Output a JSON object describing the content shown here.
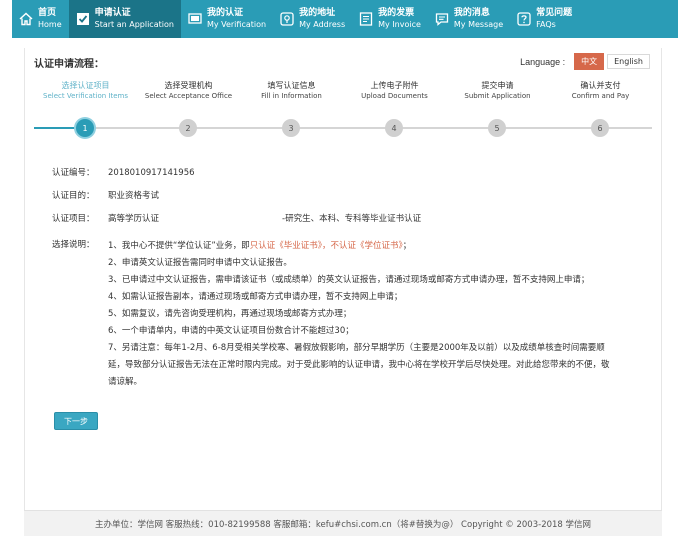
{
  "nav": [
    {
      "zh": "首页",
      "en": "Home",
      "icon": "home-icon"
    },
    {
      "zh": "申请认证",
      "en": "Start an Application",
      "icon": "checkbox-icon",
      "active": true
    },
    {
      "zh": "我的认证",
      "en": "My Verification",
      "icon": "monitor-icon"
    },
    {
      "zh": "我的地址",
      "en": "My Address",
      "icon": "location-icon"
    },
    {
      "zh": "我的发票",
      "en": "My Invoice",
      "icon": "invoice-icon"
    },
    {
      "zh": "我的消息",
      "en": "My Message",
      "icon": "message-icon"
    },
    {
      "zh": "常见问题",
      "en": "FAQs",
      "icon": "question-icon"
    }
  ],
  "process_title": "认证申请流程：",
  "language": {
    "label": "Language :",
    "zh": "中文",
    "en": "English"
  },
  "steps": [
    {
      "num": "1",
      "zh": "选择认证项目",
      "en": "Select Verification Items",
      "active": true
    },
    {
      "num": "2",
      "zh": "选择受理机构",
      "en": "Select Acceptance Office"
    },
    {
      "num": "3",
      "zh": "填写认证信息",
      "en": "Fill in Information"
    },
    {
      "num": "4",
      "zh": "上传电子附件",
      "en": "Upload Documents"
    },
    {
      "num": "5",
      "zh": "提交申请",
      "en": "Submit Application"
    },
    {
      "num": "6",
      "zh": "确认并支付",
      "en": "Confirm and Pay"
    }
  ],
  "info": {
    "id_label": "认证编号：",
    "id_value": "20180109171419​56",
    "purpose_label": "认证目的：",
    "purpose_value": "职业资格考试",
    "project_label": "认证项目：",
    "project_value": "高等学历认证",
    "project_note": "-研究生、本科、专科等毕业证书认证",
    "notes_label": "选择说明："
  },
  "notes": {
    "n1a": "1、我中心不提供“学位认证”业务，即",
    "n1b": "只认证《毕业证书》，不认证《学位证书》",
    "n1c": "；",
    "n2": "2、申请英文认证报告需同时申请中文认证报告。",
    "n3": "3、已申请过中文认证报告，需申请该证书（或成绩单）的英文认证报告，请通过现场或邮寄方式申请办理，暂不支持网上申请；",
    "n4": "4、如需认证报告副本，请通过现场或邮寄方式申请办理，暂不支持网上申请；",
    "n5": "5、如需复议，请先咨询受理机构，再通过现场或邮寄方式办理；",
    "n6": "6、一个申请单内，申请的中英文认证项目份数合计不能超过30；",
    "n7a": "7、另请注意：每年1-2月、6-8月受相关学校寒、暑假放假影响，部分早期学历（主要是2000年及以前）以及成绩单核查时间需要顺",
    "n7b": "延，导致部分认证报告无法在正常时限内完成。对于受此影响的认证申请，我中心将在学校开学后尽快处理。对此给您带来的不便，敬",
    "n7c": "请谅解。"
  },
  "next_label": "下一步",
  "footer": "主办单位：学信网    客服热线：010-82199588    客服邮箱：kefu#chsi.com.cn（将#替换为@）    Copyright © 2003-2018 学信网"
}
